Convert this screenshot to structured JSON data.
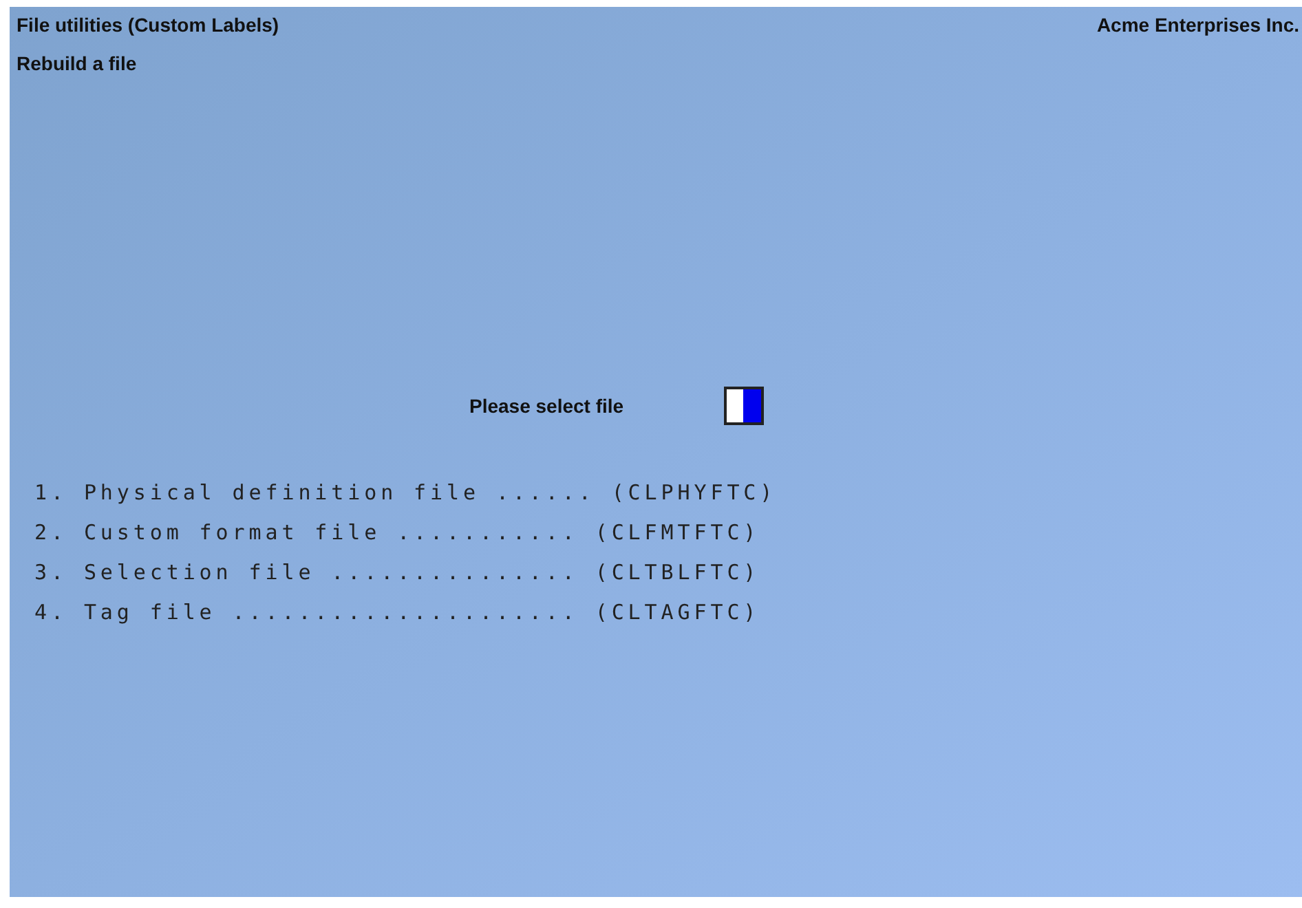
{
  "header": {
    "title": "File utilities (Custom Labels)",
    "company": "Acme Enterprises Inc.",
    "subtitle": "Rebuild a file"
  },
  "prompt": {
    "label": "Please select file"
  },
  "options": [
    {
      "text": "1. Physical definition file ...... (CLPHYFTC)"
    },
    {
      "text": "2. Custom format file ........... (CLFMTFTC)"
    },
    {
      "text": "3. Selection file ............... (CLTBLFTC)"
    },
    {
      "text": "4. Tag file ..................... (CLTAGFTC)"
    }
  ]
}
